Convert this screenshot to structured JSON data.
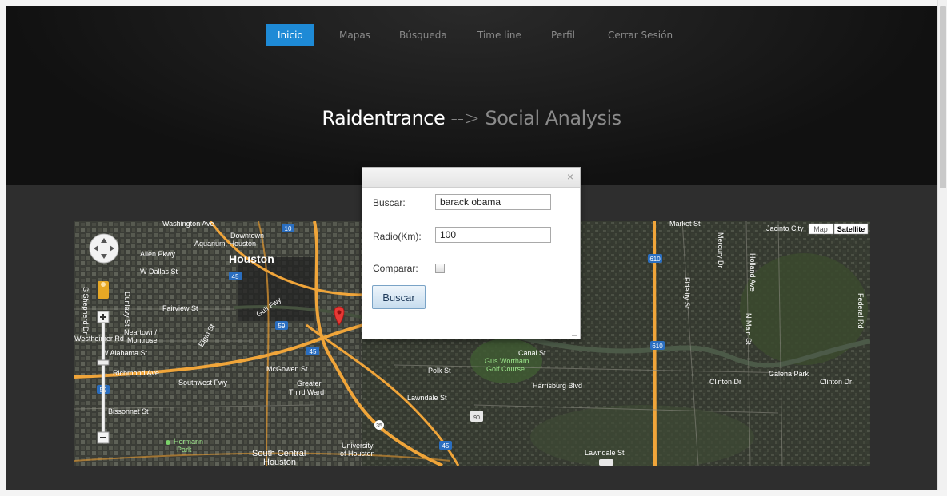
{
  "nav": {
    "items": [
      {
        "label": "Inicio",
        "active": true
      },
      {
        "label": "Mapas",
        "active": false
      },
      {
        "label": "Búsqueda",
        "active": false
      },
      {
        "label": "Time line",
        "active": false
      },
      {
        "label": "Perfil",
        "active": false
      },
      {
        "label": "Cerrar Sesión",
        "active": false
      }
    ]
  },
  "header": {
    "brand": "Raidentrance",
    "separator": "-->",
    "subtitle": "Social Analysis"
  },
  "map": {
    "type_buttons": [
      "Map",
      "Satellite"
    ],
    "labels": {
      "houston": "Houston",
      "downtown": "Downtown",
      "aquarium": "Aquarium, Houston",
      "allen_pkwy": "Allen Pkwy",
      "w_dallas": "W Dallas St",
      "fairview": "Fairview St",
      "neartown": "Neartown/",
      "montrose": "Montrose",
      "w_alabama": "W Alabama St",
      "richmond": "Richmond Ave",
      "bissonnet": "Bissonnet St",
      "southwest_fwy": "Southwest Fwy",
      "greater_third_ward": "Greater",
      "third_ward": "Third Ward",
      "south_central": "South Central",
      "south_central_2": "Houston",
      "university": "University",
      "of_houston": "of Houston",
      "hermann": "Hermann",
      "park": "Park",
      "gus_wortham": "Gus Wortham",
      "golf_course": "Golf Course",
      "polk_st": "Polk St",
      "canal_st": "Canal St",
      "harrisburg": "Harrisburg Blvd",
      "lawndale": "Lawndale St",
      "clinton_dr": "Clinton Dr",
      "clinton_dr_2": "Clinton Dr",
      "galena_park": "Galena Park",
      "jacinto_city": "Jacinto City",
      "market_st": "Market St",
      "washington": "Washington Ave",
      "mercury_dr": "Mercury Dr",
      "holland_ave": "Holland Ave",
      "federal_rd": "Federal Rd",
      "n_main_st": "N Main St",
      "fidelity_st": "Fidelity St",
      "gulf_fwy": "Gulf Fwy",
      "mcgowen": "McGowen St",
      "elgin": "Elgin St",
      "dunlavy": "Dunlavy St",
      "shepherd": "S Shepherd Dr",
      "westheimer": "Westheimer Rd",
      "hwy_10": "10",
      "hwy_45": "45",
      "hwy_59": "59",
      "hwy_610": "610",
      "hwy_35": "35",
      "hwy_90": "90",
      "hwy_225": "225"
    }
  },
  "search_dialog": {
    "close_icon": "×",
    "buscar_label": "Buscar:",
    "buscar_value": "barack obama",
    "radio_label": "Radio(Km):",
    "radio_value": "100",
    "comparar_label": "Comparar:",
    "comparar_checked": false,
    "submit_label": "Buscar"
  },
  "colors": {
    "accent": "#1e8ad6",
    "header_bg": "#111111",
    "content_bg": "#2e2e2e",
    "map_road": "#f0a53a",
    "marker": "#e53935"
  }
}
